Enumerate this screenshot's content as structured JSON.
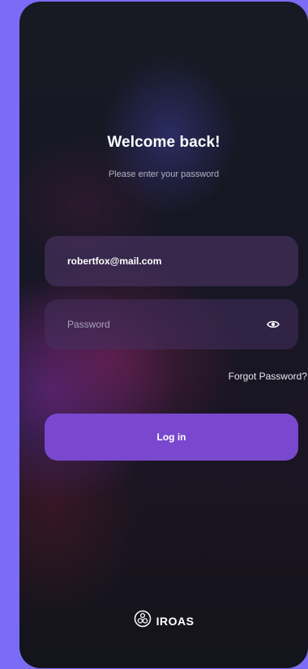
{
  "header": {
    "title": "Welcome back!",
    "subtitle": "Please enter your password"
  },
  "form": {
    "email": {
      "value": "robertfox@mail.com"
    },
    "password": {
      "value": "",
      "placeholder": "Password",
      "toggle_icon": "eye-icon"
    },
    "forgot_label": "Forgot Password?",
    "login_label": "Log in"
  },
  "brand": {
    "logo_icon": "iroas-logo-icon",
    "name": "IROAS"
  },
  "colors": {
    "accent": "#7a48cf",
    "page_background": "#7b6cf6",
    "field_background": "#3a2a4e"
  }
}
